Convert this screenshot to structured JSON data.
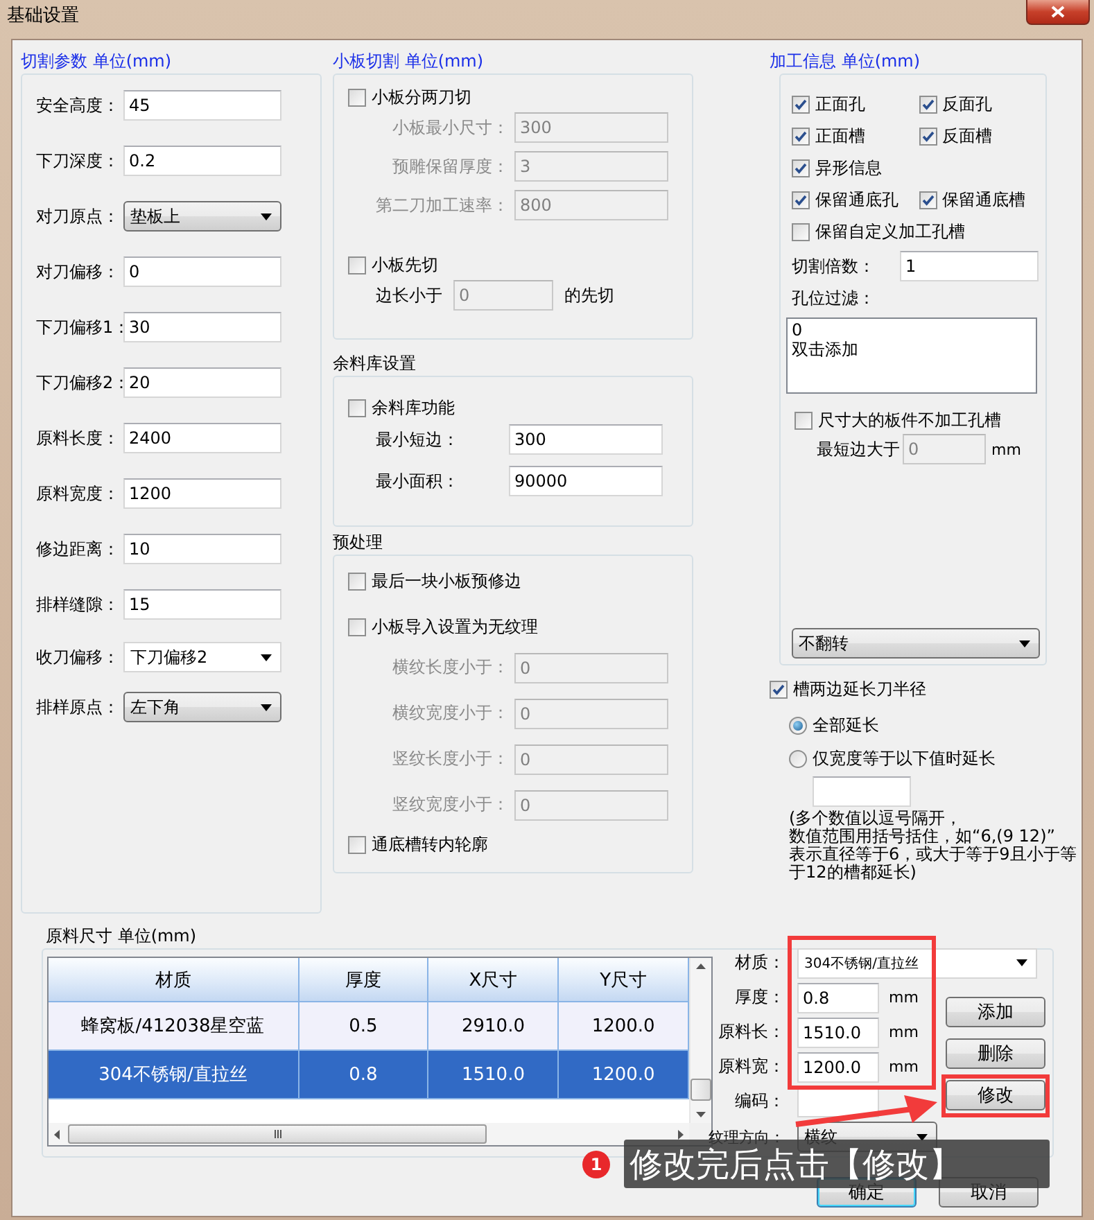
{
  "window": {
    "title": "基础设置"
  },
  "cutting_params": {
    "title": "切割参数 单位(mm)",
    "fields": [
      {
        "kind": "text",
        "label": "安全高度：",
        "value": "45"
      },
      {
        "kind": "text",
        "label": "下刀深度：",
        "value": "0.2"
      },
      {
        "kind": "select",
        "label": "对刀原点：",
        "value": "垫板上"
      },
      {
        "kind": "text",
        "label": "对刀偏移：",
        "value": "0"
      },
      {
        "kind": "text",
        "label": "下刀偏移1：",
        "value": "30"
      },
      {
        "kind": "text",
        "label": "下刀偏移2：",
        "value": "20"
      },
      {
        "kind": "text",
        "label": "原料长度：",
        "value": "2400"
      },
      {
        "kind": "text",
        "label": "原料宽度：",
        "value": "1200"
      },
      {
        "kind": "text",
        "label": "修边距离：",
        "value": "10"
      },
      {
        "kind": "text",
        "label": "排样缝隙：",
        "value": "15"
      },
      {
        "kind": "select",
        "label": "收刀偏移：",
        "value": "下刀偏移2"
      },
      {
        "kind": "select",
        "label": "排样原点：",
        "value": "左下角"
      }
    ]
  },
  "small_board": {
    "title": "小板切割 单位(mm)",
    "split_cut": {
      "label": "小板分两刀切",
      "checked": false
    },
    "split_fields": [
      {
        "label": "小板最小尺寸：",
        "value": "300",
        "disabled": true
      },
      {
        "label": "预雕保留厚度：",
        "value": "3",
        "disabled": true
      },
      {
        "label": "第二刀加工速率：",
        "value": "800",
        "disabled": true
      }
    ],
    "cut_first": {
      "label": "小板先切",
      "checked": false
    },
    "cut_first_row": {
      "prefix": "边长小于",
      "value": "0",
      "suffix": "的先切",
      "disabled": true
    }
  },
  "offcut_library": {
    "title": "余料库设置",
    "enable": {
      "label": "余料库功能",
      "checked": false
    },
    "fields": [
      {
        "label": "最小短边：",
        "value": "300"
      },
      {
        "label": "最小面积：",
        "value": "90000"
      }
    ]
  },
  "preprocess": {
    "title": "预处理",
    "trim_last": {
      "label": "最后一块小板预修边",
      "checked": false
    },
    "no_grain": {
      "label": "小板导入设置为无纹理",
      "checked": false
    },
    "grain_fields": [
      {
        "label": "横纹长度小于：",
        "value": "0",
        "disabled": true
      },
      {
        "label": "横纹宽度小于：",
        "value": "0",
        "disabled": true
      },
      {
        "label": "竖纹长度小于：",
        "value": "0",
        "disabled": true
      },
      {
        "label": "竖纹宽度小于：",
        "value": "0",
        "disabled": true
      }
    ],
    "through_slot": {
      "label": "通底槽转内轮廓",
      "checked": false
    }
  },
  "machining_info": {
    "title": "加工信息 单位(mm)",
    "option_rows": [
      [
        {
          "label": "正面孔",
          "checked": true
        },
        {
          "label": "反面孔",
          "checked": true
        }
      ],
      [
        {
          "label": "正面槽",
          "checked": true
        },
        {
          "label": "反面槽",
          "checked": true
        }
      ],
      [
        {
          "label": "异形信息",
          "checked": true
        }
      ],
      [
        {
          "label": "保留通底孔",
          "checked": true
        },
        {
          "label": "保留通底槽",
          "checked": true
        }
      ],
      [
        {
          "label": "保留自定义加工孔槽",
          "checked": false
        }
      ]
    ],
    "cut_multiplier": {
      "label": "切割倍数：",
      "value": "1"
    },
    "hole_filter": {
      "label": "孔位过滤：",
      "items": [
        "0",
        "双击添加"
      ]
    },
    "skip_large": {
      "label": "尺寸大的板件不加工孔槽",
      "checked": false
    },
    "min_edge": {
      "prefix": "最短边大于",
      "value": "0",
      "unit": "mm",
      "disabled": true
    },
    "flip": {
      "value": "不翻转"
    }
  },
  "slot_extend": {
    "label": "槽两边延长刀半径",
    "checked": true,
    "modes": [
      {
        "label": "全部延长",
        "selected": true
      },
      {
        "label": "仅宽度等于以下值时延长",
        "selected": false
      }
    ],
    "note_lines": [
      "(多个数值以逗号隔开，",
      "数值范围用括号括住，如“6,(9 12)”",
      "表示直径等于6，或大于等于9且小于等",
      "于12的槽都延长)"
    ]
  },
  "raw_material": {
    "title": "原料尺寸 单位(mm)",
    "table": {
      "columns": [
        "材质",
        "厚度",
        "X尺寸",
        "Y尺寸"
      ],
      "rows": [
        {
          "cells": [
            "蜂窝板/412038星空蓝",
            "0.5",
            "2910.0",
            "1200.0"
          ],
          "selected": false
        },
        {
          "cells": [
            "304不锈钢/直拉丝",
            "0.8",
            "1510.0",
            "1200.0"
          ],
          "selected": true
        }
      ]
    },
    "form": [
      {
        "kind": "select",
        "label": "材质：",
        "value": "304不锈钢/直拉丝"
      },
      {
        "kind": "text",
        "label": "厚度：",
        "value": "0.8",
        "unit": "mm"
      },
      {
        "kind": "text",
        "label": "原料长：",
        "value": "1510.0",
        "unit": "mm"
      },
      {
        "kind": "text",
        "label": "原料宽：",
        "value": "1200.0",
        "unit": "mm"
      },
      {
        "kind": "text",
        "label": "编码："
      },
      {
        "kind": "select",
        "label": "纹理方向：",
        "value": "横纹"
      }
    ],
    "buttons": [
      "添加",
      "删除",
      "修改"
    ]
  },
  "dialog_buttons": [
    "确定",
    "取消"
  ],
  "annotation": {
    "badge": "1",
    "text": "修改完后点击【修改】"
  }
}
